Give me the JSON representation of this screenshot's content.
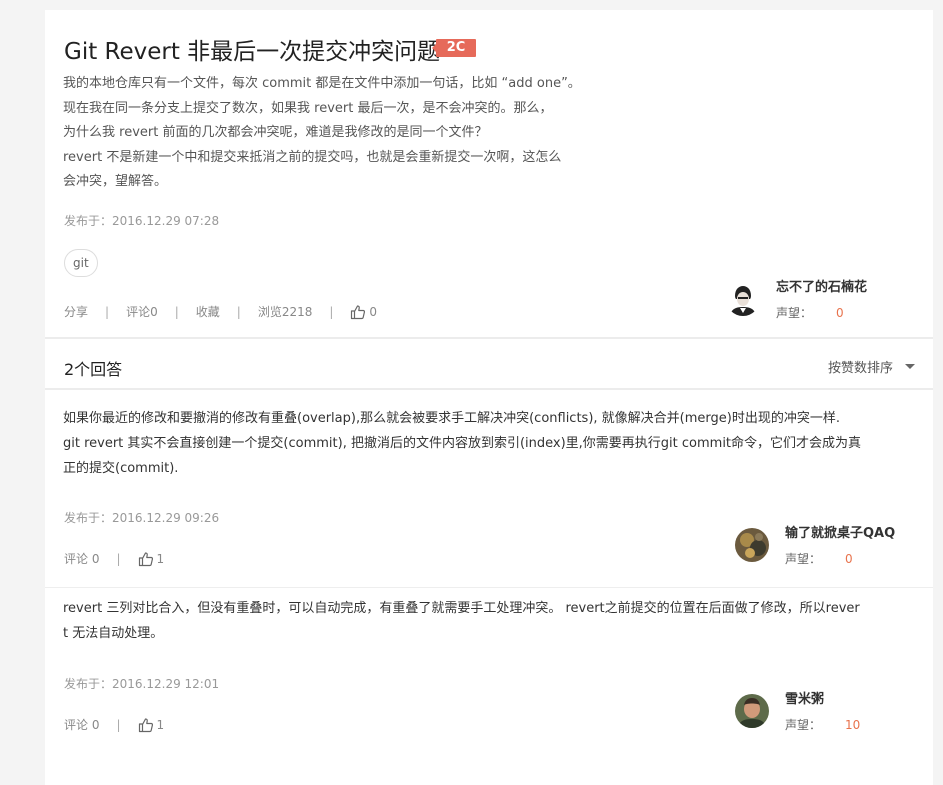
{
  "question": {
    "title": "Git Revert 非最后一次提交冲突问题",
    "badge": "2C",
    "body_lines": [
      "我的本地仓库只有一个文件，每次 commit 都是在文件中添加一句话，比如 “add one”。",
      "现在我在同一条分支上提交了数次，如果我 revert 最后一次，是不会冲突的。那么，",
      "为什么我 revert 前面的几次都会冲突呢，难道是我修改的是同一个文件？",
      "revert 不是新建一个中和提交来抵消之前的提交吗，也就是会重新提交一次啊，这怎么",
      "会冲突，望解答。"
    ],
    "time": "发布于：2016.12.29 07:28",
    "tag": "git",
    "actions": {
      "share": "分享",
      "comments": "评论0",
      "favorite": "收藏",
      "views": "浏览2218",
      "likes": "0"
    },
    "author": {
      "name": "忘不了的石楠花",
      "rep_label": "声望：",
      "rep_value": "0"
    }
  },
  "answers_header": {
    "count": "2个回答",
    "sort": "按赞数排序"
  },
  "answers": [
    {
      "body_lines": [
        "如果你最近的修改和要撤消的修改有重叠(overlap),那么就会被要求手工解决冲突(conflicts),    就像解决合并(merge)时出现的冲突一样.",
        "git revert 其实不会直接创建一个提交(commit), 把撤消后的文件内容放到索引(index)里,你需要再执行git commit命令，它们才会成为真",
        "正的提交(commit)."
      ],
      "time": "发布于：2016.12.29 09:26",
      "comments": "评论 0",
      "likes": "1",
      "author": {
        "name": "输了就掀桌子QAQ",
        "rep_label": "声望：",
        "rep_value": "0"
      }
    },
    {
      "body_lines": [
        "revert 三列对比合入，但没有重叠时，可以自动完成，有重叠了就需要手工处理冲突。 revert之前提交的位置在后面做了修改，所以rever",
        "t 无法自动处理。"
      ],
      "time": "发布于：2016.12.29 12:01",
      "comments": "评论 0",
      "likes": "1",
      "author": {
        "name": "雪米粥",
        "rep_label": "声望：",
        "rep_value": "10"
      }
    }
  ],
  "colors": {
    "accent": "#e66a5a",
    "reputation": "#e8734d"
  },
  "icons": [
    "thumbs-up-icon",
    "chevron-down-icon"
  ]
}
